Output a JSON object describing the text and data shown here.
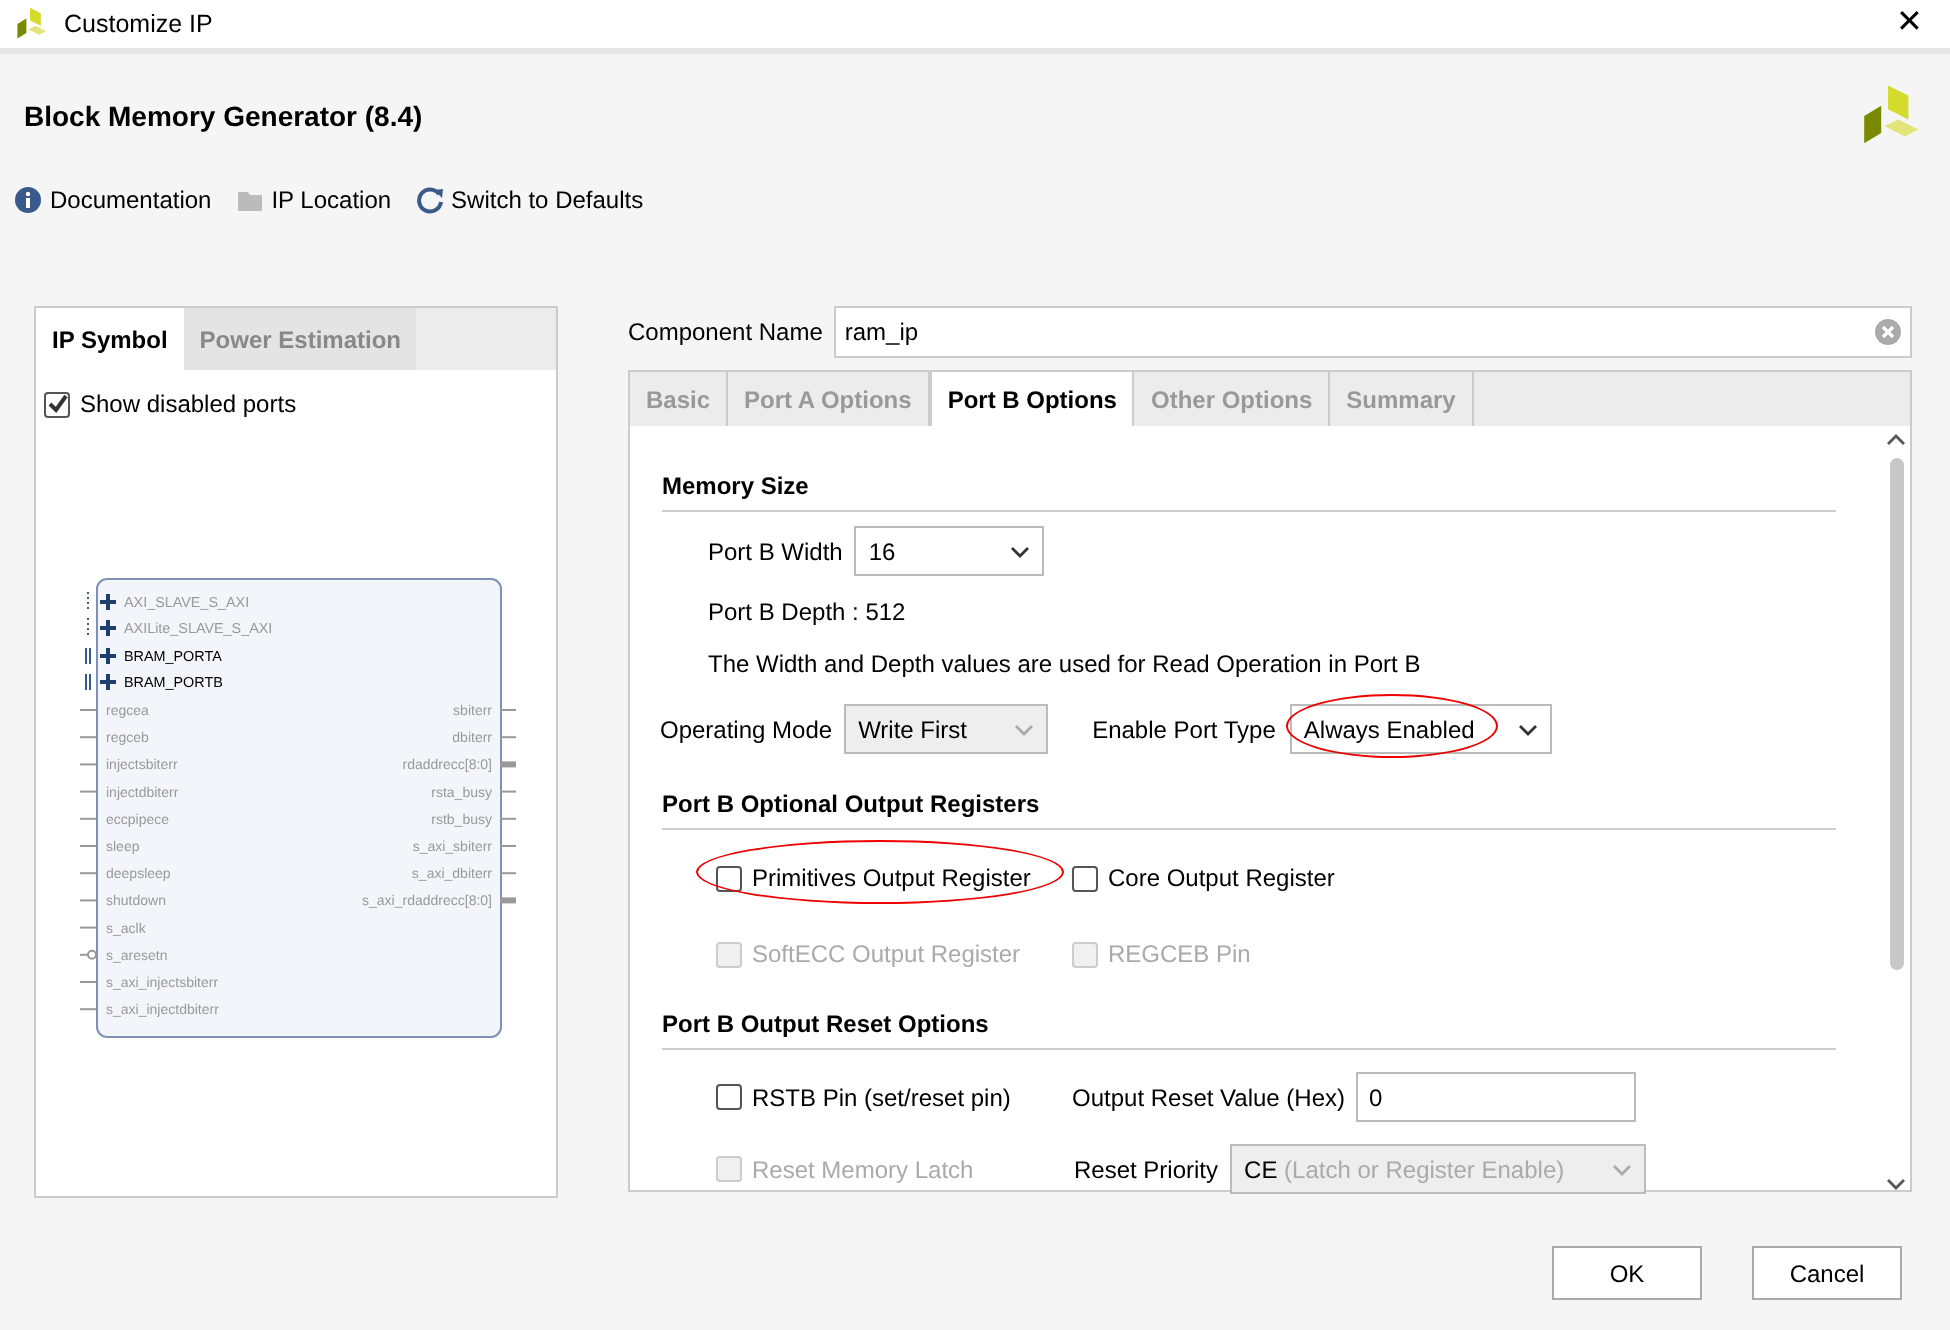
{
  "window": {
    "title": "Customize IP",
    "close": "✕"
  },
  "header": {
    "title": "Block Memory Generator (8.4)"
  },
  "toolbar": [
    {
      "label": "Documentation",
      "kind": "info"
    },
    {
      "label": "IP Location",
      "kind": "folder"
    },
    {
      "label": "Switch to Defaults",
      "kind": "refresh"
    }
  ],
  "left_panel": {
    "tabs": [
      {
        "label": "IP Symbol",
        "selected": true
      },
      {
        "label": "Power Estimation",
        "selected": false
      }
    ],
    "show_disabled_ports": {
      "label": "Show disabled ports",
      "checked": true
    },
    "symbol": {
      "interfaces": [
        {
          "name": "AXI_SLAVE_S_AXI",
          "enabled": false
        },
        {
          "name": "AXILite_SLAVE_S_AXI",
          "enabled": false
        },
        {
          "name": "BRAM_PORTA",
          "enabled": true
        },
        {
          "name": "BRAM_PORTB",
          "enabled": true
        }
      ],
      "left_ports": [
        {
          "name": "regcea",
          "kind": "single"
        },
        {
          "name": "regceb",
          "kind": "single"
        },
        {
          "name": "injectsbiterr",
          "kind": "single"
        },
        {
          "name": "injectdbiterr",
          "kind": "single"
        },
        {
          "name": "eccpipece",
          "kind": "single"
        },
        {
          "name": "sleep",
          "kind": "single"
        },
        {
          "name": "deepsleep",
          "kind": "single"
        },
        {
          "name": "shutdown",
          "kind": "single"
        },
        {
          "name": "s_aclk",
          "kind": "single"
        },
        {
          "name": "s_aresetn",
          "kind": "inverted"
        },
        {
          "name": "s_axi_injectsbiterr",
          "kind": "single"
        },
        {
          "name": "s_axi_injectdbiterr",
          "kind": "single"
        }
      ],
      "right_ports": [
        {
          "name": "sbiterr",
          "kind": "single"
        },
        {
          "name": "dbiterr",
          "kind": "single"
        },
        {
          "name": "rdaddrecc[8:0]",
          "kind": "bus"
        },
        {
          "name": "rsta_busy",
          "kind": "single"
        },
        {
          "name": "rstb_busy",
          "kind": "single"
        },
        {
          "name": "s_axi_sbiterr",
          "kind": "single"
        },
        {
          "name": "s_axi_dbiterr",
          "kind": "single"
        },
        {
          "name": "s_axi_rdaddrecc[8:0]",
          "kind": "bus"
        }
      ]
    }
  },
  "component_name": {
    "label": "Component Name",
    "value": "ram_ip"
  },
  "tabs": [
    {
      "label": "Basic",
      "selected": false
    },
    {
      "label": "Port A Options",
      "selected": false
    },
    {
      "label": "Port B Options",
      "selected": true
    },
    {
      "label": "Other Options",
      "selected": false
    },
    {
      "label": "Summary",
      "selected": false
    }
  ],
  "memory_size": {
    "title": "Memory Size",
    "width": {
      "label": "Port B Width",
      "value": "16"
    },
    "depth": "Port B Depth : 512",
    "note": "The Width and Depth values are used for Read Operation in Port B",
    "operating_mode": {
      "label": "Operating Mode",
      "value": "Write First",
      "disabled": true
    },
    "enable_port_type": {
      "label": "Enable Port Type",
      "value": "Always Enabled",
      "disabled": false,
      "highlighted": true
    }
  },
  "output_registers": {
    "title": "Port B Optional Output Registers",
    "options": [
      {
        "label": "Primitives Output Register",
        "checked": false,
        "disabled": false,
        "highlighted": true
      },
      {
        "label": "Core Output Register",
        "checked": false,
        "disabled": false,
        "highlighted": false
      },
      {
        "label": "SoftECC Output Register",
        "checked": false,
        "disabled": true,
        "highlighted": false
      },
      {
        "label": "REGCEB Pin",
        "checked": false,
        "disabled": true,
        "highlighted": false
      }
    ]
  },
  "reset_options": {
    "title": "Port B Output Reset Options",
    "rstb_pin": {
      "label": "RSTB Pin (set/reset pin)",
      "checked": false,
      "disabled": false
    },
    "reset_value": {
      "label": "Output Reset Value (Hex)",
      "value": "0"
    },
    "reset_memory_latch": {
      "label": "Reset Memory Latch",
      "checked": false,
      "disabled": true
    },
    "reset_priority": {
      "label": "Reset Priority",
      "value": "CE",
      "value_note": "(Latch or Register Enable)",
      "disabled": true
    }
  },
  "buttons": [
    "OK",
    "Cancel"
  ]
}
